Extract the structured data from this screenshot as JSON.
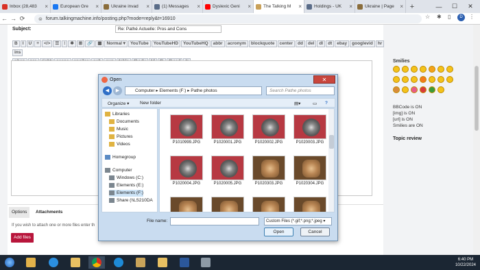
{
  "browser": {
    "tabs": [
      {
        "title": "Inbox (28,483",
        "color": "#d93025"
      },
      {
        "title": "European Gre",
        "color": "#1877f2"
      },
      {
        "title": "Ukraine invad",
        "color": "#8a6d3b"
      },
      {
        "title": "(1) Messages",
        "color": "#5a6c88"
      },
      {
        "title": "Dyslexic Geni",
        "color": "#ff0000"
      },
      {
        "title": "The Talking M",
        "color": "#c9a15a"
      },
      {
        "title": "Holdings - UK",
        "color": "#5a6c88"
      },
      {
        "title": "Ukraine | Page",
        "color": "#8a6d3b"
      }
    ],
    "url": "forum.talkingmachine.info/posting.php?mode=reply&t=16910",
    "profile_initial": "D"
  },
  "post": {
    "subject_label": "Subject:",
    "subject_value": "Re: Pathé Actuelle: Pros and Cons",
    "bbcode_buttons_row1": [
      "B",
      "I",
      "U",
      "≡",
      "</>",
      "☰",
      "⁝",
      "✱",
      "⊞",
      "🔗",
      "▦",
      "Normal ▾",
      "YouTube",
      "YouTubeHD",
      "YouTubeHQ",
      "abbr",
      "acronym",
      "blockquote",
      "center",
      "dd",
      "del",
      "dl",
      "dt",
      "ebay",
      "googlevid",
      "hr",
      "ins"
    ],
    "bbcode_buttons_row2": [
      "nbsp",
      "pre",
      "right",
      "scaps",
      "spoiler",
      "sub",
      "sup",
      "table",
      "tbody",
      "td",
      "th",
      "thead",
      "tr"
    ],
    "tabs": {
      "options": "Options",
      "attachments": "Attachments"
    },
    "attach_hint": "If you wish to attach one or more files enter th",
    "add_files": "Add files"
  },
  "sidebar": {
    "smilies_title": "Smilies",
    "bbcode_status": "BBCode is ON",
    "img_status": "[img] is ON",
    "url_status": "[url] is ON",
    "smilies_status": "Smilies are ON",
    "topic_review": "Topic review"
  },
  "dialog": {
    "title": "Open",
    "breadcrumb": "Computer ▸ Elements (F:) ▸ Pathe photos",
    "search_placeholder": "Search Pathe photos",
    "organize": "Organize ▾",
    "new_folder": "New folder",
    "tree": [
      {
        "label": "Libraries",
        "type": "lib"
      },
      {
        "label": "Documents",
        "type": "lib"
      },
      {
        "label": "Music",
        "type": "lib"
      },
      {
        "label": "Pictures",
        "type": "lib"
      },
      {
        "label": "Videos",
        "type": "lib"
      },
      {
        "label": "Homegroup",
        "type": "home"
      },
      {
        "label": "Computer",
        "type": "drive"
      },
      {
        "label": "Windows (C:)",
        "type": "drive"
      },
      {
        "label": "Elements (E:)",
        "type": "drive"
      },
      {
        "label": "Elements (F:)",
        "type": "drive"
      },
      {
        "label": "Share (\\\\LS210DA",
        "type": "drive"
      }
    ],
    "files": [
      {
        "name": "P1010999.JPG",
        "style": "disc"
      },
      {
        "name": "P1020001.JPG",
        "style": "disc"
      },
      {
        "name": "P1020002.JPG",
        "style": "disc"
      },
      {
        "name": "P1020003.JPG",
        "style": "disc"
      },
      {
        "name": "P1020004.JPG",
        "style": "disc"
      },
      {
        "name": "P1020005.JPG",
        "style": "disc"
      },
      {
        "name": "P1020303.JPG",
        "style": "brown"
      },
      {
        "name": "P1020304.JPG",
        "style": "brown"
      },
      {
        "name": "",
        "style": "brown"
      },
      {
        "name": "",
        "style": "brown"
      },
      {
        "name": "",
        "style": "brown"
      },
      {
        "name": "",
        "style": "brown"
      }
    ],
    "file_name_label": "File name:",
    "file_name_value": "",
    "file_type": "Custom Files (*.gif;*.png;*.jpeg ▾",
    "open_button": "Open",
    "cancel_button": "Cancel"
  },
  "taskbar": {
    "time": "6:40 PM",
    "date": "10/22/2024"
  }
}
